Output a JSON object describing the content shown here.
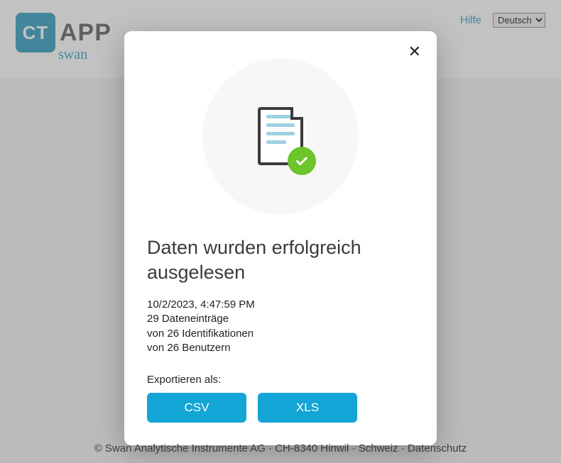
{
  "header": {
    "logo_ct": "CT",
    "logo_app": "APP",
    "logo_swan": "swan",
    "help": "Hilfe",
    "language_selected": "Deutsch"
  },
  "modal": {
    "title": "Daten wurden erfolgreich ausgelesen",
    "timestamp": "10/2/2023, 4:47:59 PM",
    "entries_line": "29 Dateneinträge",
    "ident_line": "von 26 Identifikationen",
    "users_line": "von 26 Benutzern",
    "export_label": "Exportieren als:",
    "csv_label": "CSV",
    "xls_label": "XLS"
  },
  "footer": {
    "copyright": "© Swan Analytische Instrumente AG · CH-8340 Hinwil · Schweiz · ",
    "privacy": "Datenschutz"
  }
}
